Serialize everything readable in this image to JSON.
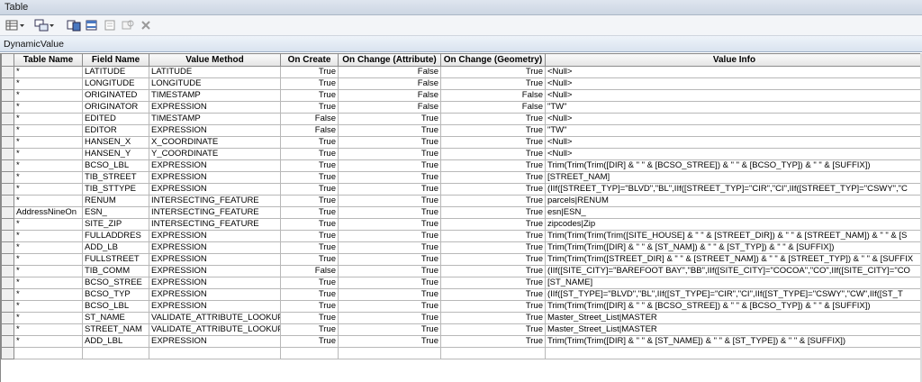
{
  "window": {
    "title": "Table"
  },
  "tab": {
    "label": "DynamicValue"
  },
  "toolbar": {
    "icons": [
      "table-options-icon",
      "dropdown-arrow-icon",
      "related-tables-icon",
      "dropdown-arrow-icon",
      "select-by-attributes-icon",
      "switch-selection-icon",
      "clear-selection-icon",
      "zoom-to-selected-icon",
      "delete-selected-icon"
    ]
  },
  "table": {
    "headers": [
      "",
      "Table Name",
      "Field Name",
      "Value Method",
      "On Create",
      "On Change (Attribute)",
      "On Change (Geometry)",
      "Value Info"
    ],
    "rows": [
      [
        "*",
        "LATITUDE",
        "LATITUDE",
        "True",
        "False",
        "True",
        "<Null>"
      ],
      [
        "*",
        "LONGITUDE",
        "LONGITUDE",
        "True",
        "False",
        "True",
        "<Null>"
      ],
      [
        "*",
        "ORIGINATED",
        "TIMESTAMP",
        "True",
        "False",
        "False",
        "<Null>"
      ],
      [
        "*",
        "ORIGINATOR",
        "EXPRESSION",
        "True",
        "False",
        "False",
        "\"TW\""
      ],
      [
        "*",
        "EDITED",
        "TIMESTAMP",
        "False",
        "True",
        "True",
        "<Null>"
      ],
      [
        "*",
        "EDITOR",
        "EXPRESSION",
        "False",
        "True",
        "True",
        "\"TW\""
      ],
      [
        "*",
        "HANSEN_X",
        "X_COORDINATE",
        "True",
        "True",
        "True",
        "<Null>"
      ],
      [
        "*",
        "HANSEN_Y",
        "Y_COORDINATE",
        "True",
        "True",
        "True",
        "<Null>"
      ],
      [
        "*",
        "BCSO_LBL",
        "EXPRESSION",
        "True",
        "True",
        "True",
        "Trim(Trim(Trim([DIR] & \" \" & [BCSO_STREE]) & \" \" & [BCSO_TYP]) & \" \" & [SUFFIX])"
      ],
      [
        "*",
        "TIB_STREET",
        "EXPRESSION",
        "True",
        "True",
        "True",
        "[STREET_NAM]"
      ],
      [
        "*",
        "TIB_STTYPE",
        "EXPRESSION",
        "True",
        "True",
        "True",
        "(IIf([STREET_TYP]=\"BLVD\",\"BL\",IIf([STREET_TYP]=\"CIR\",\"CI\",IIf([STREET_TYP]=\"CSWY\",\"C"
      ],
      [
        "*",
        "RENUM",
        "INTERSECTING_FEATURE",
        "True",
        "True",
        "True",
        "parcels|RENUM"
      ],
      [
        "AddressNineOn",
        "ESN_",
        "INTERSECTING_FEATURE",
        "True",
        "True",
        "True",
        "esn|ESN_"
      ],
      [
        "*",
        "SITE_ZIP",
        "INTERSECTING_FEATURE",
        "True",
        "True",
        "True",
        "zipcodes|Zip"
      ],
      [
        "*",
        "FULLADDRES",
        "EXPRESSION",
        "True",
        "True",
        "True",
        "Trim(Trim(Trim(Trim([SITE_HOUSE] & \" \" & [STREET_DIR]) & \" \" & [STREET_NAM]) & \" \" & [S"
      ],
      [
        "*",
        "ADD_LB",
        "EXPRESSION",
        "True",
        "True",
        "True",
        "Trim(Trim(Trim([DIR] & \" \" & [ST_NAM]) & \" \" & [ST_TYP]) & \" \" & [SUFFIX])"
      ],
      [
        "*",
        "FULLSTREET",
        "EXPRESSION",
        "True",
        "True",
        "True",
        "Trim(Trim(Trim([STREET_DIR] & \" \" & [STREET_NAM]) & \" \" & [STREET_TYP]) & \" \" & [SUFFIX"
      ],
      [
        "*",
        "TIB_COMM",
        "EXPRESSION",
        "False",
        "True",
        "True",
        "(IIf([SITE_CITY]=\"BAREFOOT BAY\",\"BB\",IIf([SITE_CITY]=\"COCOA\",\"CO\",IIf([SITE_CITY]=\"CO"
      ],
      [
        "*",
        "BCSO_STREE",
        "EXPRESSION",
        "True",
        "True",
        "True",
        "[ST_NAME]"
      ],
      [
        "*",
        "BCSO_TYP",
        "EXPRESSION",
        "True",
        "True",
        "True",
        "(IIf([ST_TYPE]=\"BLVD\",\"BL\",IIf([ST_TYPE]=\"CIR\",\"CI\",IIf([ST_TYPE]=\"CSWY\",\"CW\",IIf([ST_T"
      ],
      [
        "*",
        "BCSO_LBL",
        "EXPRESSION",
        "True",
        "True",
        "True",
        "Trim(Trim(Trim([DIR] & \" \" & [BCSO_STREE]) & \" \" & [BCSO_TYP]) & \" \" & [SUFFIX])"
      ],
      [
        "*",
        "ST_NAME",
        "VALIDATE_ATTRIBUTE_LOOKUP",
        "True",
        "True",
        "True",
        "Master_Street_List|MASTER"
      ],
      [
        "*",
        "STREET_NAM",
        "VALIDATE_ATTRIBUTE_LOOKUP",
        "True",
        "True",
        "True",
        "Master_Street_List|MASTER"
      ],
      [
        "*",
        "ADD_LBL",
        "EXPRESSION",
        "True",
        "True",
        "True",
        "Trim(Trim(Trim([DIR] & \" \" & [ST_NAME]) & \" \" & [ST_TYPE]) & \" \" & [SUFFIX])"
      ]
    ]
  }
}
